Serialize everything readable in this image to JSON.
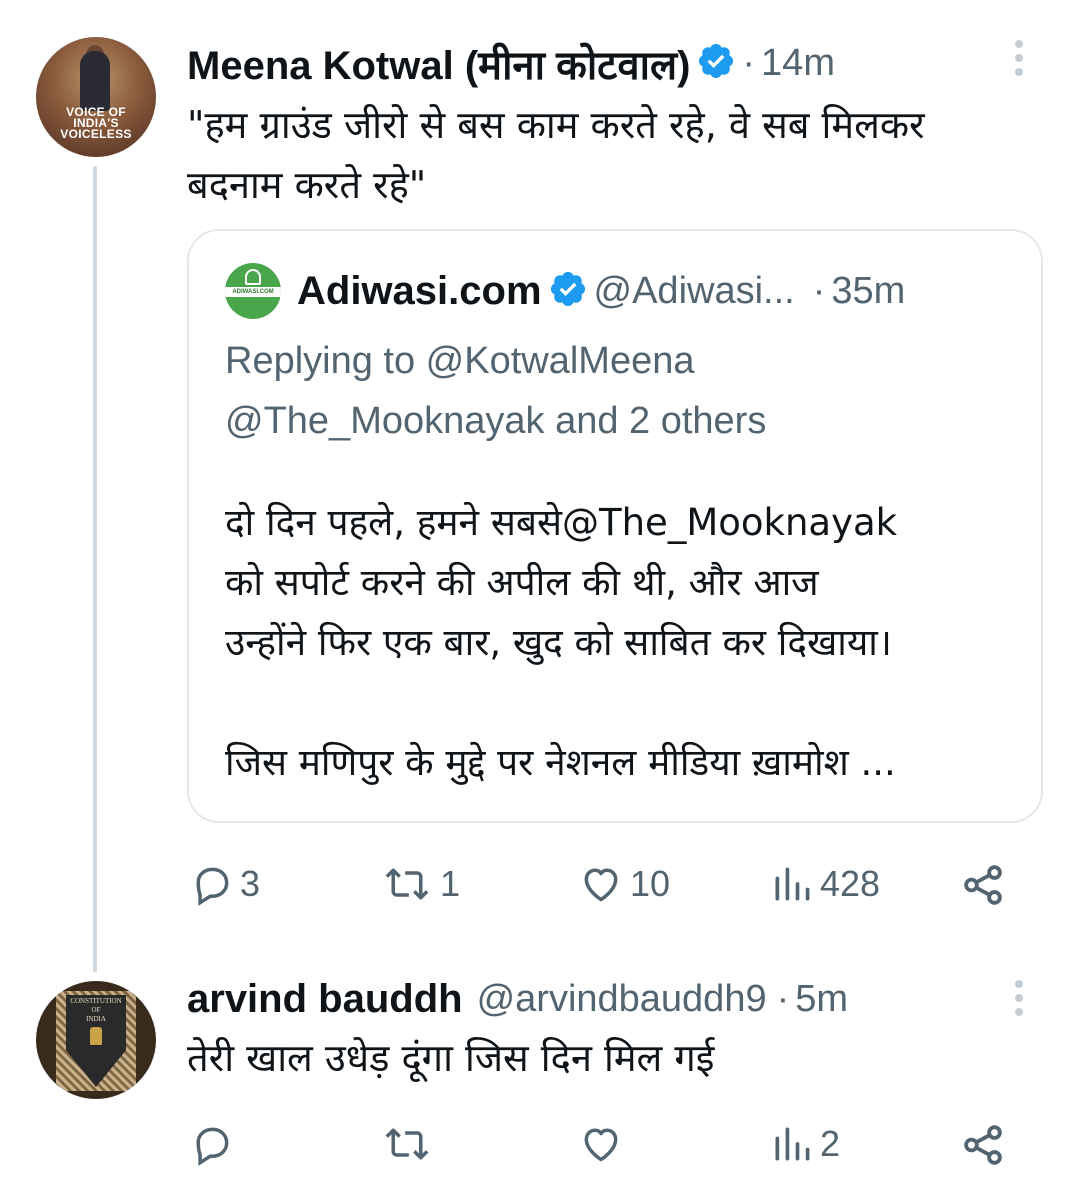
{
  "tweet1": {
    "author_name": "Meena Kotwal (मीना कोटवाल)",
    "dot": "·",
    "time": "14m",
    "avatar_text": [
      "VOICE OF",
      "INDIA'S",
      "VOICELESS"
    ],
    "text_lines": [
      "\"हम ग्राउंड जीरो से बस काम करते रहे, वे सब मिलकर",
      "बदनाम करते रहे\""
    ],
    "actions": {
      "replies": "3",
      "retweets": "1",
      "likes": "10",
      "views": "428"
    }
  },
  "quote": {
    "author_name": "Adiwasi.com",
    "handle": "@Adiwasi...",
    "dot": "·",
    "time": "35m",
    "logo_text": "ADIWASI.COM",
    "replying_lines": [
      "Replying to @KotwalMeena",
      "@The_Mooknayak and 2 others"
    ],
    "body_lines": [
      "दो दिन पहले, हमने सबसे@The_Mooknayak",
      "को सपोर्ट करने की अपील की थी, और आज",
      "उन्होंने फिर एक बार, खुद को साबित कर दिखाया।",
      "",
      "जिस मणिपुर के मुद्दे पर नेशनल मीडिया ख़ामोश ..."
    ]
  },
  "tweet2": {
    "author_name": "arvind bauddh",
    "handle": "@arvindbauddh9",
    "dot": "·",
    "time": "5m",
    "avatar_text": [
      "CONSTITUTION",
      "OF",
      "INDIA"
    ],
    "text": "तेरी खाल उधेड़ दूंगा जिस दिन मिल गई",
    "actions": {
      "replies": "",
      "retweets": "",
      "likes": "",
      "views": "2"
    }
  },
  "colors": {
    "verified": "#1d9bf0",
    "muted": "#536471",
    "thread_line": "#cfd9de",
    "logo_green": "#4aa64a"
  },
  "icons": [
    "verified-badge-icon",
    "more-icon",
    "reply-icon",
    "retweet-icon",
    "like-icon",
    "views-icon",
    "share-icon"
  ]
}
